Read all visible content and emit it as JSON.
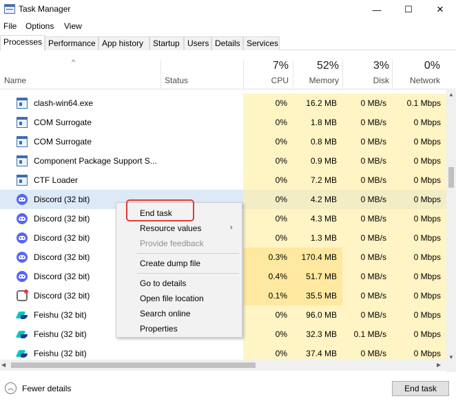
{
  "window": {
    "title": "Task Manager",
    "minimize": "—",
    "maximize": "☐",
    "close": "✕"
  },
  "menu": [
    {
      "label": "File"
    },
    {
      "label": "Options"
    },
    {
      "label": "View"
    }
  ],
  "tabs": [
    {
      "label": "Processes"
    },
    {
      "label": "Performance"
    },
    {
      "label": "App history"
    },
    {
      "label": "Startup"
    },
    {
      "label": "Users"
    },
    {
      "label": "Details"
    },
    {
      "label": "Services"
    }
  ],
  "columns": {
    "name": "Name",
    "status": "Status",
    "cpu": {
      "pct": "7%",
      "label": "CPU"
    },
    "memory": {
      "pct": "52%",
      "label": "Memory"
    },
    "disk": {
      "pct": "3%",
      "label": "Disk"
    },
    "network": {
      "pct": "0%",
      "label": "Network"
    }
  },
  "processes": [
    {
      "name": "clash-win64.exe",
      "icon": "app-window-icon",
      "cpu": "0%",
      "memory": "16.2 MB",
      "disk": "0 MB/s",
      "network": "0.1 Mbps"
    },
    {
      "name": "COM Surrogate",
      "icon": "app-window-icon",
      "cpu": "0%",
      "memory": "1.8 MB",
      "disk": "0 MB/s",
      "network": "0 Mbps"
    },
    {
      "name": "COM Surrogate",
      "icon": "app-window-icon",
      "cpu": "0%",
      "memory": "0.8 MB",
      "disk": "0 MB/s",
      "network": "0 Mbps"
    },
    {
      "name": "Component Package Support S...",
      "icon": "app-window-icon",
      "cpu": "0%",
      "memory": "0.9 MB",
      "disk": "0 MB/s",
      "network": "0 Mbps"
    },
    {
      "name": "CTF Loader",
      "icon": "app-window-icon",
      "cpu": "0%",
      "memory": "7.2 MB",
      "disk": "0 MB/s",
      "network": "0 Mbps"
    },
    {
      "name": "Discord (32 bit)",
      "icon": "discord-icon",
      "cpu": "0%",
      "memory": "4.2 MB",
      "disk": "0 MB/s",
      "network": "0 Mbps",
      "selected": true
    },
    {
      "name": "Discord (32 bit)",
      "icon": "discord-icon",
      "cpu": "0%",
      "memory": "4.3 MB",
      "disk": "0 MB/s",
      "network": "0 Mbps"
    },
    {
      "name": "Discord (32 bit)",
      "icon": "discord-icon",
      "cpu": "0%",
      "memory": "1.3 MB",
      "disk": "0 MB/s",
      "network": "0 Mbps"
    },
    {
      "name": "Discord (32 bit)",
      "icon": "discord-icon",
      "cpu": "0.3%",
      "memory": "170.4 MB",
      "disk": "0 MB/s",
      "network": "0 Mbps"
    },
    {
      "name": "Discord (32 bit)",
      "icon": "discord-icon",
      "cpu": "0.4%",
      "memory": "51.7 MB",
      "disk": "0 MB/s",
      "network": "0 Mbps"
    },
    {
      "name": "Discord (32 bit)",
      "icon": "discord-notify-icon",
      "cpu": "0.1%",
      "memory": "35.5 MB",
      "disk": "0 MB/s",
      "network": "0 Mbps"
    },
    {
      "name": "Feishu (32 bit)",
      "icon": "feishu-icon",
      "cpu": "0%",
      "memory": "96.0 MB",
      "disk": "0 MB/s",
      "network": "0 Mbps"
    },
    {
      "name": "Feishu (32 bit)",
      "icon": "feishu-icon",
      "cpu": "0%",
      "memory": "32.3 MB",
      "disk": "0.1 MB/s",
      "network": "0 Mbps"
    },
    {
      "name": "Feishu (32 bit)",
      "icon": "feishu-icon",
      "cpu": "0%",
      "memory": "37.4 MB",
      "disk": "0 MB/s",
      "network": "0 Mbps"
    }
  ],
  "context_menu": {
    "end_task": "End task",
    "resource_values": "Resource values",
    "provide_feedback": "Provide feedback",
    "create_dump": "Create dump file",
    "go_to_details": "Go to details",
    "open_file_location": "Open file location",
    "search_online": "Search online",
    "properties": "Properties",
    "submenu_arrow": "›"
  },
  "footer": {
    "fewer_details": "Fewer details",
    "fewer_icon": "chevron-up-icon",
    "end_task": "End task"
  },
  "colors": {
    "highlight_cell": "#fff4c4",
    "selected_row": "#dce9f7",
    "annotation_box": "#e53935"
  }
}
